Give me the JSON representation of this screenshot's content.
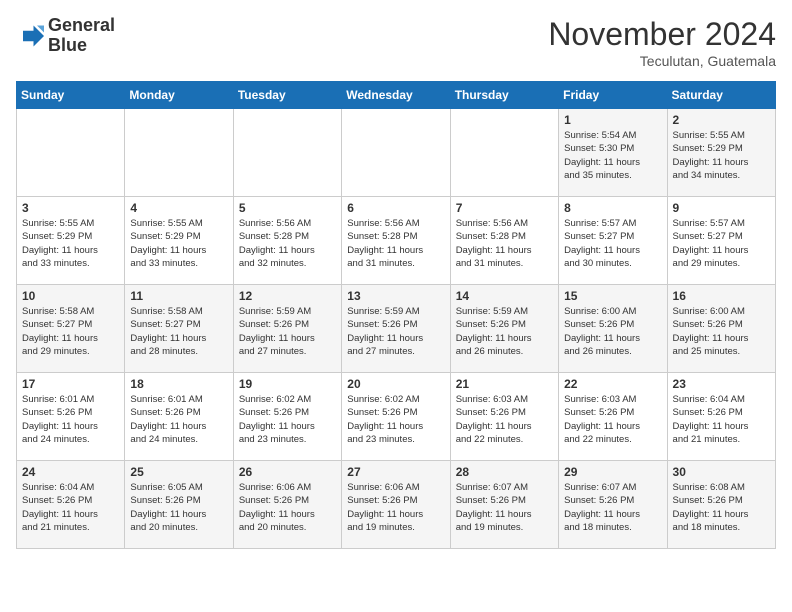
{
  "logo": {
    "line1": "General",
    "line2": "Blue"
  },
  "title": "November 2024",
  "subtitle": "Teculutan, Guatemala",
  "days_of_week": [
    "Sunday",
    "Monday",
    "Tuesday",
    "Wednesday",
    "Thursday",
    "Friday",
    "Saturday"
  ],
  "weeks": [
    [
      {
        "day": "",
        "info": ""
      },
      {
        "day": "",
        "info": ""
      },
      {
        "day": "",
        "info": ""
      },
      {
        "day": "",
        "info": ""
      },
      {
        "day": "",
        "info": ""
      },
      {
        "day": "1",
        "info": "Sunrise: 5:54 AM\nSunset: 5:30 PM\nDaylight: 11 hours\nand 35 minutes."
      },
      {
        "day": "2",
        "info": "Sunrise: 5:55 AM\nSunset: 5:29 PM\nDaylight: 11 hours\nand 34 minutes."
      }
    ],
    [
      {
        "day": "3",
        "info": "Sunrise: 5:55 AM\nSunset: 5:29 PM\nDaylight: 11 hours\nand 33 minutes."
      },
      {
        "day": "4",
        "info": "Sunrise: 5:55 AM\nSunset: 5:29 PM\nDaylight: 11 hours\nand 33 minutes."
      },
      {
        "day": "5",
        "info": "Sunrise: 5:56 AM\nSunset: 5:28 PM\nDaylight: 11 hours\nand 32 minutes."
      },
      {
        "day": "6",
        "info": "Sunrise: 5:56 AM\nSunset: 5:28 PM\nDaylight: 11 hours\nand 31 minutes."
      },
      {
        "day": "7",
        "info": "Sunrise: 5:56 AM\nSunset: 5:28 PM\nDaylight: 11 hours\nand 31 minutes."
      },
      {
        "day": "8",
        "info": "Sunrise: 5:57 AM\nSunset: 5:27 PM\nDaylight: 11 hours\nand 30 minutes."
      },
      {
        "day": "9",
        "info": "Sunrise: 5:57 AM\nSunset: 5:27 PM\nDaylight: 11 hours\nand 29 minutes."
      }
    ],
    [
      {
        "day": "10",
        "info": "Sunrise: 5:58 AM\nSunset: 5:27 PM\nDaylight: 11 hours\nand 29 minutes."
      },
      {
        "day": "11",
        "info": "Sunrise: 5:58 AM\nSunset: 5:27 PM\nDaylight: 11 hours\nand 28 minutes."
      },
      {
        "day": "12",
        "info": "Sunrise: 5:59 AM\nSunset: 5:26 PM\nDaylight: 11 hours\nand 27 minutes."
      },
      {
        "day": "13",
        "info": "Sunrise: 5:59 AM\nSunset: 5:26 PM\nDaylight: 11 hours\nand 27 minutes."
      },
      {
        "day": "14",
        "info": "Sunrise: 5:59 AM\nSunset: 5:26 PM\nDaylight: 11 hours\nand 26 minutes."
      },
      {
        "day": "15",
        "info": "Sunrise: 6:00 AM\nSunset: 5:26 PM\nDaylight: 11 hours\nand 26 minutes."
      },
      {
        "day": "16",
        "info": "Sunrise: 6:00 AM\nSunset: 5:26 PM\nDaylight: 11 hours\nand 25 minutes."
      }
    ],
    [
      {
        "day": "17",
        "info": "Sunrise: 6:01 AM\nSunset: 5:26 PM\nDaylight: 11 hours\nand 24 minutes."
      },
      {
        "day": "18",
        "info": "Sunrise: 6:01 AM\nSunset: 5:26 PM\nDaylight: 11 hours\nand 24 minutes."
      },
      {
        "day": "19",
        "info": "Sunrise: 6:02 AM\nSunset: 5:26 PM\nDaylight: 11 hours\nand 23 minutes."
      },
      {
        "day": "20",
        "info": "Sunrise: 6:02 AM\nSunset: 5:26 PM\nDaylight: 11 hours\nand 23 minutes."
      },
      {
        "day": "21",
        "info": "Sunrise: 6:03 AM\nSunset: 5:26 PM\nDaylight: 11 hours\nand 22 minutes."
      },
      {
        "day": "22",
        "info": "Sunrise: 6:03 AM\nSunset: 5:26 PM\nDaylight: 11 hours\nand 22 minutes."
      },
      {
        "day": "23",
        "info": "Sunrise: 6:04 AM\nSunset: 5:26 PM\nDaylight: 11 hours\nand 21 minutes."
      }
    ],
    [
      {
        "day": "24",
        "info": "Sunrise: 6:04 AM\nSunset: 5:26 PM\nDaylight: 11 hours\nand 21 minutes."
      },
      {
        "day": "25",
        "info": "Sunrise: 6:05 AM\nSunset: 5:26 PM\nDaylight: 11 hours\nand 20 minutes."
      },
      {
        "day": "26",
        "info": "Sunrise: 6:06 AM\nSunset: 5:26 PM\nDaylight: 11 hours\nand 20 minutes."
      },
      {
        "day": "27",
        "info": "Sunrise: 6:06 AM\nSunset: 5:26 PM\nDaylight: 11 hours\nand 19 minutes."
      },
      {
        "day": "28",
        "info": "Sunrise: 6:07 AM\nSunset: 5:26 PM\nDaylight: 11 hours\nand 19 minutes."
      },
      {
        "day": "29",
        "info": "Sunrise: 6:07 AM\nSunset: 5:26 PM\nDaylight: 11 hours\nand 18 minutes."
      },
      {
        "day": "30",
        "info": "Sunrise: 6:08 AM\nSunset: 5:26 PM\nDaylight: 11 hours\nand 18 minutes."
      }
    ]
  ]
}
